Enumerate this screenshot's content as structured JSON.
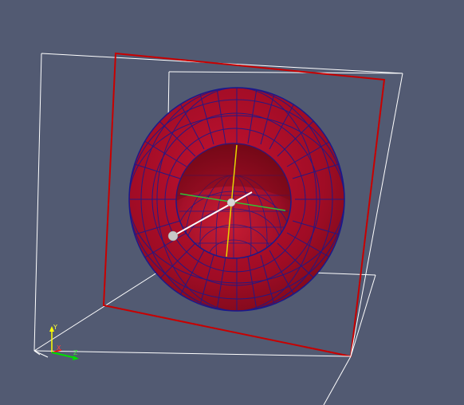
{
  "viewport": {
    "background": "#525a72"
  },
  "scene": {
    "objects": [
      {
        "name": "outline-box",
        "color": "#ffffff"
      },
      {
        "name": "plane-widget-outline",
        "color": "#cc0000"
      },
      {
        "name": "spherical-shell",
        "color": "#a3001e",
        "edge_color": "#1a1a8c"
      },
      {
        "name": "plane-normal-handle",
        "color": "#ffffff"
      },
      {
        "name": "plane-center-axes",
        "colors": [
          "#ffff00",
          "#00cc00"
        ]
      }
    ]
  },
  "orientation_axes": {
    "labels": {
      "x": "X",
      "y": "Y",
      "z": "Z"
    },
    "colors": {
      "x": "#ff0000",
      "y": "#ffff00",
      "z": "#00ff00"
    }
  }
}
